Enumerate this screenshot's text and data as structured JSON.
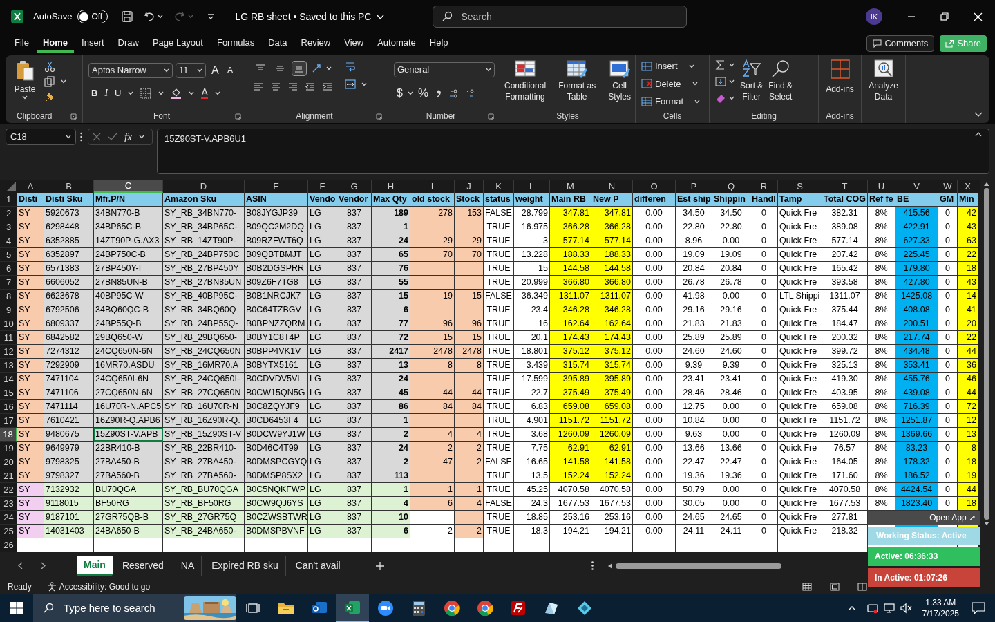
{
  "title_bar": {
    "autosave_label": "AutoSave",
    "autosave_state": "Off",
    "autosave_on": false,
    "title": "LG RB sheet • Saved to this PC",
    "search_placeholder": "Search",
    "avatar": "IK"
  },
  "menu_tabs": [
    {
      "label": "File",
      "selected": false
    },
    {
      "label": "Home",
      "selected": true
    },
    {
      "label": "Insert",
      "selected": false
    },
    {
      "label": "Draw",
      "selected": false
    },
    {
      "label": "Page Layout",
      "selected": false
    },
    {
      "label": "Formulas",
      "selected": false
    },
    {
      "label": "Data",
      "selected": false
    },
    {
      "label": "Review",
      "selected": false
    },
    {
      "label": "View",
      "selected": false
    },
    {
      "label": "Automate",
      "selected": false
    },
    {
      "label": "Help",
      "selected": false
    }
  ],
  "comments": "Comments",
  "share": "Share",
  "ribbon": {
    "clipboard": {
      "paste": "Paste",
      "group": "Clipboard"
    },
    "font": {
      "name": "Aptos Narrow",
      "size": "11",
      "grow": "A",
      "shrink": "A",
      "bold": "B",
      "italic": "I",
      "underline": "U",
      "color_letter": "A",
      "group": "Font"
    },
    "alignment": {
      "vertical_align": [
        {
          "selected": false
        },
        {
          "selected": false
        },
        {
          "selected": true
        }
      ],
      "group": "Alignment"
    },
    "number": {
      "format": "General",
      "currency": "$",
      "percent": "%",
      "group": "Number"
    },
    "styles": {
      "items": [
        "Conditional\nFormatting",
        "Format as\nTable",
        "Cell\nStyles"
      ],
      "group": "Styles"
    },
    "cells": {
      "items": [
        "Insert",
        "Delete",
        "Format"
      ],
      "group": "Cells"
    },
    "editing": {
      "items": [
        "Sort &\nFilter",
        "Find &\nSelect"
      ],
      "group": "Editing"
    },
    "addins": {
      "label": "Add-ins",
      "group": "Add-ins"
    },
    "analyze": "Analyze\nData"
  },
  "formula_bar": {
    "name_box": "C18",
    "fx": "fx",
    "formula": "15Z90ST-V.APB6U1"
  },
  "sheet": {
    "columns": [
      {
        "letter": "A",
        "selected": false
      },
      {
        "letter": "B",
        "selected": false
      },
      {
        "letter": "C",
        "selected": true
      },
      {
        "letter": "D",
        "selected": false
      },
      {
        "letter": "E",
        "selected": false
      },
      {
        "letter": "F",
        "selected": false
      },
      {
        "letter": "G",
        "selected": false
      },
      {
        "letter": "H",
        "selected": false
      },
      {
        "letter": "I",
        "selected": false
      },
      {
        "letter": "J",
        "selected": false
      },
      {
        "letter": "K",
        "selected": false
      },
      {
        "letter": "L",
        "selected": false
      },
      {
        "letter": "M",
        "selected": false
      },
      {
        "letter": "N",
        "selected": false
      },
      {
        "letter": "O",
        "selected": false
      },
      {
        "letter": "P",
        "selected": false
      },
      {
        "letter": "Q",
        "selected": false
      },
      {
        "letter": "R",
        "selected": false
      },
      {
        "letter": "S",
        "selected": false
      },
      {
        "letter": "T",
        "selected": false
      },
      {
        "letter": "U",
        "selected": false
      },
      {
        "letter": "V",
        "selected": false
      },
      {
        "letter": "W",
        "selected": false
      },
      {
        "letter": "X",
        "selected": false
      }
    ],
    "rows": [
      {
        "number": "1",
        "kind": "header",
        "selected": false,
        "cells": [
          "Disti",
          "Disti Sku",
          "Mfr.P/N",
          "Amazon Sku",
          "ASIN",
          "Vendo",
          "Vendor",
          "Max Qty",
          "old stock",
          "Stock",
          "status",
          "weight",
          "Main RB",
          "New P",
          "differen",
          "Est ship",
          "Shippin",
          "Handl",
          "Tamp",
          "Total COG",
          "Ref fe",
          "BE",
          "GM",
          "Min"
        ]
      },
      {
        "number": "2",
        "kind": "main",
        "selected": false,
        "old_stock_highlight": true,
        "cells": [
          "SY",
          "5920673",
          "34BN770-B",
          "SY_RB_34BN770-",
          "B08JYGJP39",
          "LG",
          "837",
          "189",
          "278",
          "153",
          "FALSE",
          "28.799",
          "347.81",
          "347.81",
          "0.00",
          "34.50",
          "34.50",
          "0",
          "Quick Fre",
          "382.31",
          "8%",
          "415.56",
          "0",
          "42"
        ]
      },
      {
        "number": "3",
        "kind": "main",
        "selected": false,
        "old_stock_highlight": true,
        "cells": [
          "SY",
          "6298448",
          "34BP65C-B",
          "SY_RB_34BP65C-",
          "B09QC2M2DQ",
          "LG",
          "837",
          "1",
          null,
          null,
          "TRUE",
          "16.975",
          "366.28",
          "366.28",
          "0.00",
          "22.80",
          "22.80",
          "0",
          "Quick Fre",
          "389.08",
          "8%",
          "422.91",
          "0",
          "43"
        ]
      },
      {
        "number": "4",
        "kind": "main",
        "selected": false,
        "old_stock_highlight": true,
        "cells": [
          "SY",
          "6352885",
          "14ZT90P-G.AX3",
          "SY_RB_14ZT90P-",
          "B09RZFWT6Q",
          "LG",
          "837",
          "24",
          "29",
          "29",
          "TRUE",
          "3",
          "577.14",
          "577.14",
          "0.00",
          "8.96",
          "0.00",
          "0",
          "Quick Fre",
          "577.14",
          "8%",
          "627.33",
          "0",
          "63"
        ]
      },
      {
        "number": "5",
        "kind": "main",
        "selected": false,
        "old_stock_highlight": true,
        "cells": [
          "SY",
          "6352897",
          "24BP750C-B",
          "SY_RB_24BP750C",
          "B09QBTBMJT",
          "LG",
          "837",
          "65",
          "70",
          "70",
          "TRUE",
          "13.228",
          "188.33",
          "188.33",
          "0.00",
          "19.09",
          "19.09",
          "0",
          "Quick Fre",
          "207.42",
          "8%",
          "225.45",
          "0",
          "22"
        ]
      },
      {
        "number": "6",
        "kind": "main",
        "selected": false,
        "old_stock_highlight": true,
        "cells": [
          "SY",
          "6571383",
          "27BP450Y-I",
          "SY_RB_27BP450Y",
          "B0B2DGSPRR",
          "LG",
          "837",
          "76",
          null,
          null,
          "TRUE",
          "15",
          "144.58",
          "144.58",
          "0.00",
          "20.84",
          "20.84",
          "0",
          "Quick Fre",
          "165.42",
          "8%",
          "179.80",
          "0",
          "18"
        ]
      },
      {
        "number": "7",
        "kind": "main",
        "selected": false,
        "old_stock_highlight": true,
        "cells": [
          "SY",
          "6606052",
          "27BN85UN-B",
          "SY_RB_27BN85UN",
          "B09Z6F7TG8",
          "LG",
          "837",
          "55",
          null,
          null,
          "TRUE",
          "20.999",
          "366.80",
          "366.80",
          "0.00",
          "26.78",
          "26.78",
          "0",
          "Quick Fre",
          "393.58",
          "8%",
          "427.80",
          "0",
          "43"
        ]
      },
      {
        "number": "8",
        "kind": "main",
        "selected": false,
        "old_stock_highlight": true,
        "cells": [
          "SY",
          "6623678",
          "40BP95C-W",
          "SY_RB_40BP95C-",
          "B0B1NRCJK7",
          "LG",
          "837",
          "15",
          "19",
          "15",
          "FALSE",
          "36.349",
          "1311.07",
          "1311.07",
          "0.00",
          "41.98",
          "0.00",
          "0",
          "LTL Shippi",
          "1311.07",
          "8%",
          "1425.08",
          "0",
          "14"
        ]
      },
      {
        "number": "9",
        "kind": "main",
        "selected": false,
        "old_stock_highlight": true,
        "cells": [
          "SY",
          "6792506",
          "34BQ60QC-B",
          "SY_RB_34BQ60Q",
          "B0C64TZBGV",
          "LG",
          "837",
          "6",
          null,
          null,
          "TRUE",
          "23.4",
          "346.28",
          "346.28",
          "0.00",
          "29.16",
          "29.16",
          "0",
          "Quick Fre",
          "375.44",
          "8%",
          "408.08",
          "0",
          "41"
        ]
      },
      {
        "number": "10",
        "kind": "main",
        "selected": false,
        "old_stock_highlight": true,
        "cells": [
          "SY",
          "6809337",
          "24BP55Q-B",
          "SY_RB_24BP55Q-",
          "B0BPNZZQRM",
          "LG",
          "837",
          "77",
          "96",
          "96",
          "TRUE",
          "16",
          "162.64",
          "162.64",
          "0.00",
          "21.83",
          "21.83",
          "0",
          "Quick Fre",
          "184.47",
          "8%",
          "200.51",
          "0",
          "20"
        ]
      },
      {
        "number": "11",
        "kind": "main",
        "selected": false,
        "old_stock_highlight": true,
        "cells": [
          "SY",
          "6842582",
          "29BQ650-W",
          "SY_RB_29BQ650-",
          "B0BY1C8T4P",
          "LG",
          "837",
          "72",
          "15",
          "15",
          "TRUE",
          "20.1",
          "174.43",
          "174.43",
          "0.00",
          "25.89",
          "25.89",
          "0",
          "Quick Fre",
          "200.32",
          "8%",
          "217.74",
          "0",
          "22"
        ]
      },
      {
        "number": "12",
        "kind": "main",
        "selected": false,
        "old_stock_highlight": true,
        "cells": [
          "SY",
          "7274312",
          "24CQ650N-6N",
          "SY_RB_24CQ650N",
          "B0BPP4VK1V",
          "LG",
          "837",
          "2417",
          "2478",
          "2478",
          "TRUE",
          "18.801",
          "375.12",
          "375.12",
          "0.00",
          "24.60",
          "24.60",
          "0",
          "Quick Fre",
          "399.72",
          "8%",
          "434.48",
          "0",
          "44"
        ]
      },
      {
        "number": "13",
        "kind": "main",
        "selected": false,
        "old_stock_highlight": true,
        "cells": [
          "SY",
          "7292909",
          "16MR70.ASDU",
          "SY_RB_16MR70.A",
          "B0BYTX5161",
          "LG",
          "837",
          "13",
          "8",
          "8",
          "TRUE",
          "3.439",
          "315.74",
          "315.74",
          "0.00",
          "9.39",
          "9.39",
          "0",
          "Quick Fre",
          "325.13",
          "8%",
          "353.41",
          "0",
          "36"
        ]
      },
      {
        "number": "14",
        "kind": "main",
        "selected": false,
        "old_stock_highlight": true,
        "cells": [
          "SY",
          "7471104",
          "24CQ650I-6N",
          "SY_RB_24CQ650I-",
          "B0CDVDV5VL",
          "LG",
          "837",
          "24",
          null,
          null,
          "TRUE",
          "17.599",
          "395.89",
          "395.89",
          "0.00",
          "23.41",
          "23.41",
          "0",
          "Quick Fre",
          "419.30",
          "8%",
          "455.76",
          "0",
          "46"
        ]
      },
      {
        "number": "15",
        "kind": "main",
        "selected": false,
        "old_stock_highlight": true,
        "cells": [
          "SY",
          "7471106",
          "27CQ650N-6N",
          "SY_RB_27CQ650N",
          "B0CW15QN5G",
          "LG",
          "837",
          "45",
          "44",
          "44",
          "TRUE",
          "22.7",
          "375.49",
          "375.49",
          "0.00",
          "28.46",
          "28.46",
          "0",
          "Quick Fre",
          "403.95",
          "8%",
          "439.08",
          "0",
          "44"
        ]
      },
      {
        "number": "16",
        "kind": "main",
        "selected": false,
        "old_stock_highlight": true,
        "cells": [
          "SY",
          "7471114",
          "16U70R-N.APC5",
          "SY_RB_16U70R-N",
          "B0C8ZQYJF9",
          "LG",
          "837",
          "86",
          "84",
          "84",
          "TRUE",
          "6.83",
          "659.08",
          "659.08",
          "0.00",
          "12.75",
          "0.00",
          "0",
          "Quick Fre",
          "659.08",
          "8%",
          "716.39",
          "0",
          "72"
        ]
      },
      {
        "number": "17",
        "kind": "main",
        "selected": false,
        "old_stock_highlight": true,
        "cells": [
          "SY",
          "7610421",
          "16Z90R-Q.APB6",
          "SY_RB_16Z90R-Q.",
          "B0CD6453F4",
          "LG",
          "837",
          "1",
          null,
          null,
          "TRUE",
          "4.901",
          "1151.72",
          "1151.72",
          "0.00",
          "10.84",
          "0.00",
          "0",
          "Quick Fre",
          "1151.72",
          "8%",
          "1251.87",
          "0",
          "12"
        ]
      },
      {
        "number": "18",
        "kind": "main",
        "selected": true,
        "old_stock_highlight": true,
        "cells": [
          "SY",
          "9480675",
          "15Z90ST-V.APB",
          "SY_RB_15Z90ST-V",
          "B0DCW9YJ1W",
          "LG",
          "837",
          "2",
          "4",
          "4",
          "TRUE",
          "3.68",
          "1260.09",
          "1260.09",
          "0.00",
          "9.63",
          "0.00",
          "0",
          "Quick Fre",
          "1260.09",
          "8%",
          "1369.66",
          "0",
          "13"
        ]
      },
      {
        "number": "19",
        "kind": "main",
        "selected": false,
        "old_stock_highlight": true,
        "cells": [
          "SY",
          "9649979",
          "22BR410-B",
          "SY_RB_22BR410-",
          "B0D46C4T99",
          "LG",
          "837",
          "24",
          "2",
          "2",
          "TRUE",
          "7.75",
          "62.91",
          "62.91",
          "0.00",
          "13.66",
          "13.66",
          "0",
          "Quick Fre",
          "76.57",
          "8%",
          "83.23",
          "0",
          "8"
        ]
      },
      {
        "number": "20",
        "kind": "main",
        "selected": false,
        "old_stock_highlight": true,
        "cells": [
          "SY",
          "9798325",
          "27BA450-B",
          "SY_RB_27BA450-",
          "B0DMSPCGYQ",
          "LG",
          "837",
          "2",
          "47",
          "2",
          "FALSE",
          "16.65",
          "141.58",
          "141.58",
          "0.00",
          "22.47",
          "22.47",
          "0",
          "Quick Fre",
          "164.05",
          "8%",
          "178.32",
          "0",
          "18"
        ]
      },
      {
        "number": "21",
        "kind": "main",
        "selected": false,
        "old_stock_highlight": true,
        "cells": [
          "SY",
          "9798327",
          "27BA560-B",
          "SY_RB_27BA560-",
          "B0DMSP8SX2",
          "LG",
          "837",
          "113",
          null,
          null,
          "TRUE",
          "13.5",
          "152.24",
          "152.24",
          "0.00",
          "19.36",
          "19.36",
          "0",
          "Quick Fre",
          "171.60",
          "8%",
          "186.52",
          "0",
          "19"
        ]
      },
      {
        "number": "22",
        "kind": "new",
        "selected": false,
        "old_stock_highlight": true,
        "cells": [
          "SY",
          "7132932",
          "BU70QGA",
          "SY_RB_BU70QGA",
          "B0C5NQKFWP",
          "LG",
          "837",
          "1",
          "1",
          "1",
          "TRUE",
          "45.25",
          "4070.58",
          "4070.58",
          "0.00",
          "50.79",
          "0.00",
          "0",
          "Quick Fre",
          "4070.58",
          "8%",
          "4424.54",
          "0",
          "44"
        ]
      },
      {
        "number": "23",
        "kind": "new",
        "selected": false,
        "old_stock_highlight": true,
        "cells": [
          "SY",
          "9118015",
          "BF50RG",
          "SY_RB_BF50RG",
          "B0CW9QJ6YS",
          "LG",
          "837",
          "4",
          "6",
          "4",
          "FALSE",
          "24.3",
          "1677.53",
          "1677.53",
          "0.00",
          "30.05",
          "0.00",
          "0",
          "Quick Fre",
          "1677.53",
          "8%",
          "1823.40",
          "0",
          "18"
        ]
      },
      {
        "number": "24",
        "kind": "new",
        "selected": false,
        "old_stock_highlight": false,
        "cells": [
          "SY",
          "9187101",
          "27GR75QB-B",
          "SY_RB_27GR75Q",
          "B0CZWSBTWR",
          "LG",
          "837",
          "10",
          null,
          null,
          "TRUE",
          "18.85",
          "253.16",
          "253.16",
          "0.00",
          "24.65",
          "24.65",
          "0",
          "Quick Fre",
          "277.81"
        ]
      },
      {
        "number": "25",
        "kind": "new",
        "selected": false,
        "old_stock_highlight": false,
        "cells": [
          "SY",
          "14031403",
          "24BA650-B",
          "SY_RB_24BA650-",
          "B0DMSPBVNF",
          "LG",
          "837",
          "6",
          "2",
          "2",
          "TRUE",
          "18.3",
          "194.21",
          "194.21",
          "0.00",
          "24.11",
          "24.11",
          "0",
          "Quick Fre",
          "218.32"
        ]
      },
      {
        "number": "26",
        "kind": "empty",
        "selected": false
      }
    ]
  },
  "widget": {
    "open_app": "Open App ↗",
    "working_status": "Working Status: Active",
    "active": "Active: 06:36:33",
    "inactive": "In Active: 01:07:26"
  },
  "sheet_tabs": [
    {
      "label": "Main",
      "selected": true
    },
    {
      "label": "Reserved",
      "selected": false
    },
    {
      "label": "NA",
      "selected": false
    },
    {
      "label": "Expired RB sku",
      "selected": false
    },
    {
      "label": "Can't avail",
      "selected": false
    }
  ],
  "status_bar": {
    "ready": "Ready",
    "accessibility": "Accessibility: Good to go"
  },
  "taskbar": {
    "search_placeholder": "Type here to search",
    "apps": [
      {
        "kind": "task-view",
        "selected": false
      },
      {
        "kind": "folder",
        "selected": false
      },
      {
        "kind": "mail",
        "selected": false
      },
      {
        "kind": "spreadsheet",
        "selected": true
      },
      {
        "kind": "video",
        "selected": false
      },
      {
        "kind": "calculator",
        "selected": false
      },
      {
        "kind": "browser",
        "selected": false
      },
      {
        "kind": "browser",
        "selected": false
      },
      {
        "kind": "ftp",
        "selected": false
      },
      {
        "kind": "notes",
        "selected": false
      },
      {
        "kind": "diamond",
        "selected": false
      }
    ],
    "time": "1:33 AM",
    "date": "7/17/2025"
  }
}
